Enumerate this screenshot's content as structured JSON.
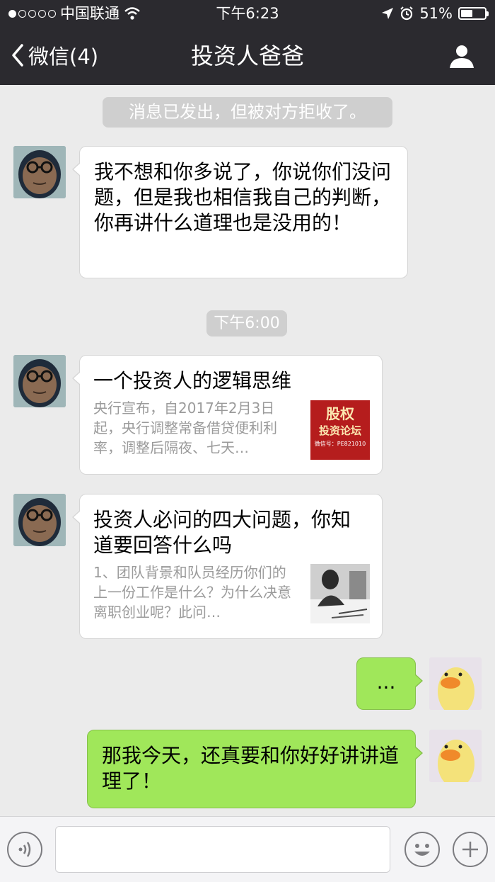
{
  "status_bar": {
    "carrier": "中国联通",
    "time": "下午6:23",
    "battery": "51%",
    "battery_level": 0.51,
    "signal_dots_filled": 1,
    "signal_dots_total": 5
  },
  "nav": {
    "back_label": "微信(4)",
    "title": "投资人爸爸"
  },
  "chat": {
    "system_notice": "消息已发出，但被对方拒收了。",
    "timestamp": "下午6:00",
    "messages": [
      {
        "text": "我不想和你多说了，你说你们没问题，但是我也相信我自己的判断，你再讲什么道理也是没用的！"
      },
      {
        "title": "一个投资人的逻辑思维",
        "desc": "央行宣布，自2017年2月3日起，央行调整常备借贷便利利率，调整后隔夜、七天…",
        "thumb_text_top": "股权",
        "thumb_text_mid": "投资论坛",
        "thumb_text_bottom": "微信号：PE821010"
      },
      {
        "title": "投资人必问的四大问题，你知道要回答什么吗",
        "desc": "1、团队背景和队员经历你们的上一份工作是什么？为什么决意离职创业呢？此问…"
      },
      {
        "text": "..."
      },
      {
        "text": "那我今天，还真要和你好好讲讲道理了！"
      }
    ]
  },
  "colors": {
    "nav_bg": "#2b2a2f",
    "chat_bg": "#ebebeb",
    "bubble_out": "#a0e75a",
    "bubble_in": "#ffffff"
  }
}
